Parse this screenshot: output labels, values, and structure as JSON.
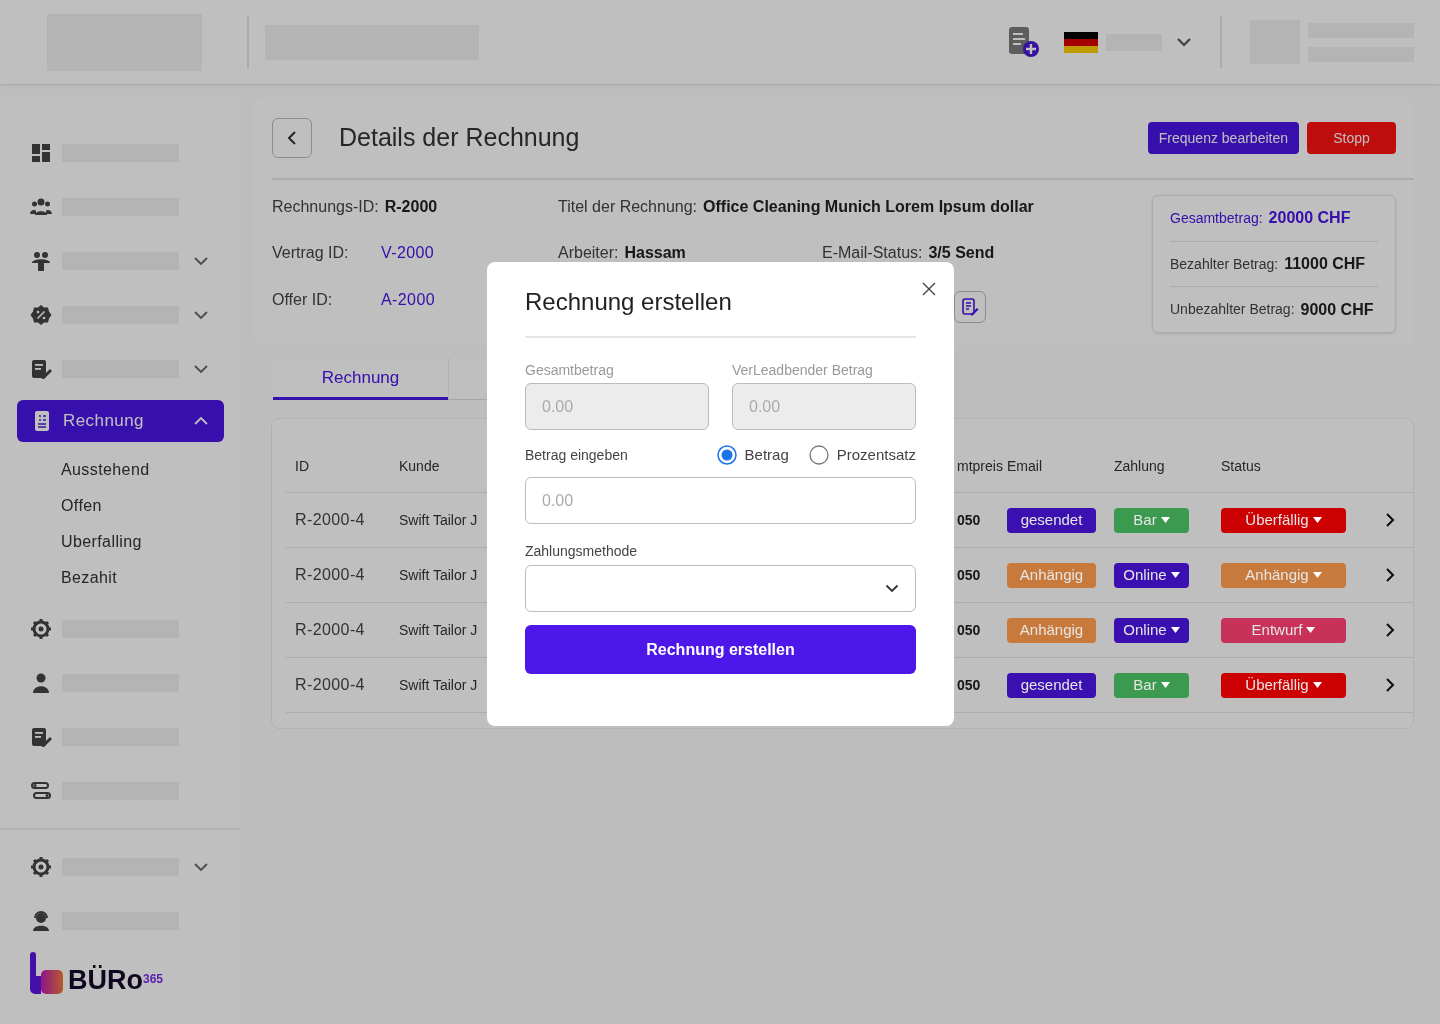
{
  "sidebar": {
    "items": [
      {
        "kind": "skeleton",
        "expandable": false
      },
      {
        "kind": "skeleton",
        "expandable": false
      },
      {
        "kind": "skeleton",
        "expandable": true
      },
      {
        "kind": "skeleton",
        "expandable": true
      },
      {
        "kind": "skeleton",
        "expandable": true
      },
      {
        "kind": "menu",
        "label": "Rechnung",
        "selected": true,
        "expanded": true,
        "children": [
          {
            "label": "Ausstehend"
          },
          {
            "label": "Offen"
          },
          {
            "label": "Uberfalling"
          },
          {
            "label": "Bezahit"
          }
        ]
      },
      {
        "kind": "skeleton",
        "expandable": false
      },
      {
        "kind": "skeleton",
        "expandable": false
      },
      {
        "kind": "skeleton",
        "expandable": false
      },
      {
        "kind": "skeleton",
        "expandable": false
      },
      {
        "kind": "divider"
      },
      {
        "kind": "skeleton",
        "expandable": true
      },
      {
        "kind": "skeleton",
        "expandable": false
      }
    ],
    "logo": "BÜRo$^{365}$"
  },
  "page": {
    "title": "Details der Rechnung",
    "buttons": [
      {
        "label": "Frequenz bearbeiten",
        "kind": "primary"
      },
      {
        "label": "Stopp",
        "kind": "danger"
      }
    ]
  },
  "details": {
    "fields": [
      {
        "label": "Rechnungs-ID:",
        "value": "R-2000",
        "link": false
      },
      {
        "label": "Titel der Rechnung:",
        "value": "Office Cleaning Munich Lorem Ipsum dollar",
        "link": false
      },
      {
        "label": "Vertrag ID:",
        "value": "V-2000",
        "link": true
      },
      {
        "label": "Arbeiter:",
        "value": "Hassam",
        "link": false
      },
      {
        "label": "E-Mail-Status:",
        "value": "3/5 Send",
        "link": false
      },
      {
        "label": "Offer ID:",
        "value": "A-2000",
        "link": true
      }
    ],
    "summary": [
      {
        "label": "Gesamtbetrag:",
        "value": "20000 CHF",
        "highlight": true
      },
      {
        "label": "Bezahlter Betrag:",
        "value": "11000 CHF",
        "highlight": false
      },
      {
        "label": "Unbezahlter Betrag:",
        "value": "9000 CHF",
        "highlight": false
      }
    ]
  },
  "tabs": [
    {
      "label": "Rechnung",
      "selected": true
    },
    {
      "selected": false
    }
  ],
  "table": {
    "columns": [
      "ID",
      "Kunde",
      "mtpreis",
      "Email",
      "Zahlung",
      "Status"
    ],
    "rows": [
      {
        "id": "R-2000-4",
        "customer": "Swift Tailor J",
        "price": "050",
        "email": {
          "label": "gesendet",
          "color": "#3b10b0",
          "dropdown": false
        },
        "payment": {
          "label": "Bar",
          "color": "#3c9a50",
          "dropdown": true
        },
        "status": {
          "label": "Überfällig",
          "color": "#cc0000",
          "dropdown": true
        }
      },
      {
        "id": "R-2000-4",
        "customer": "Swift Tailor J",
        "price": "050",
        "email": {
          "label": "Anhängig",
          "color": "#c87a3c",
          "dropdown": false
        },
        "payment": {
          "label": "Online",
          "color": "#3b10b0",
          "dropdown": true
        },
        "status": {
          "label": "Anhängig",
          "color": "#c87a3c",
          "dropdown": true
        }
      },
      {
        "id": "R-2000-4",
        "customer": "Swift Tailor J",
        "price": "050",
        "email": {
          "label": "Anhängig",
          "color": "#c87a3c",
          "dropdown": false
        },
        "payment": {
          "label": "Online",
          "color": "#3b10b0",
          "dropdown": true
        },
        "status": {
          "label": "Entwurf",
          "color": "#c8325a",
          "dropdown": true
        }
      },
      {
        "id": "R-2000-4",
        "customer": "Swift Tailor J",
        "price": "050",
        "email": {
          "label": "gesendet",
          "color": "#3b10b0",
          "dropdown": false
        },
        "payment": {
          "label": "Bar",
          "color": "#3c9a50",
          "dropdown": true
        },
        "status": {
          "label": "Überfällig",
          "color": "#cc0000",
          "dropdown": true
        }
      }
    ]
  },
  "modal": {
    "title": "Rechnung erstellen",
    "fields": [
      {
        "label": "Gesamtbetrag",
        "placeholder": "0.00",
        "disabled": true
      },
      {
        "label": "VerLeadbender Betrag",
        "placeholder": "0.00",
        "disabled": true
      }
    ],
    "amount": {
      "label": "Betrag eingeben",
      "options": [
        {
          "label": "Betrag",
          "selected": true
        },
        {
          "label": "Prozentsatz",
          "selected": false
        }
      ],
      "placeholder": "0.00"
    },
    "payment_method": {
      "label": "Zahlungsmethode"
    },
    "submit": "Rechnung erstellen"
  }
}
